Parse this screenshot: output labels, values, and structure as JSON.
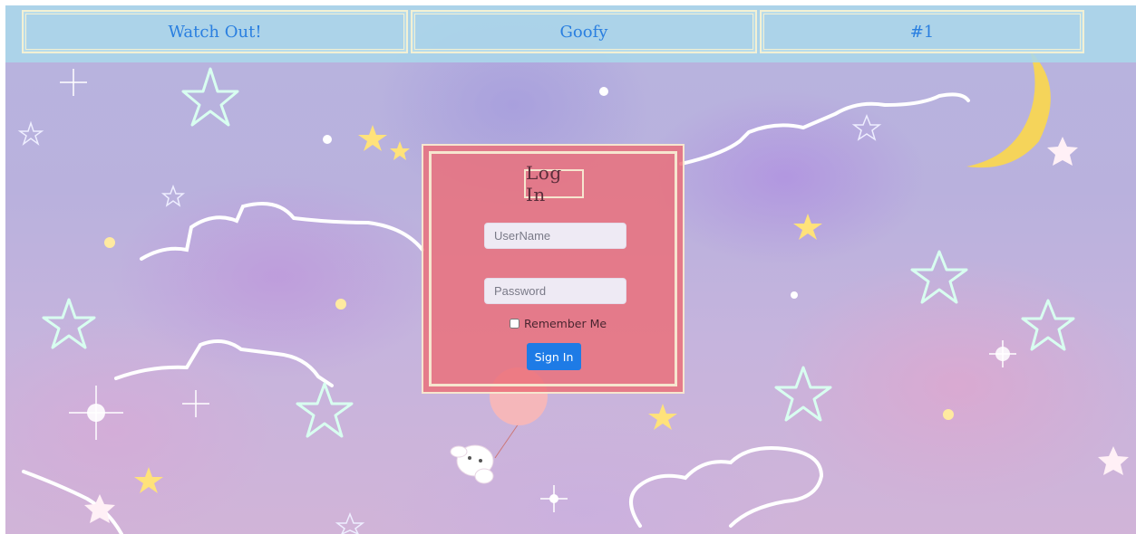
{
  "nav": {
    "items": [
      {
        "label": "Watch Out!"
      },
      {
        "label": "Goofy"
      },
      {
        "label": "#1"
      }
    ]
  },
  "login": {
    "title": "Log In",
    "username_placeholder": "UserName",
    "password_placeholder": "Password",
    "remember_label": "Remember Me",
    "sign_in_label": "Sign In"
  },
  "colors": {
    "nav_bg": "#aad7eb",
    "nav_text": "#2a7fe0",
    "card_bg": "#eb6e78",
    "button_bg": "#1e7be6"
  }
}
